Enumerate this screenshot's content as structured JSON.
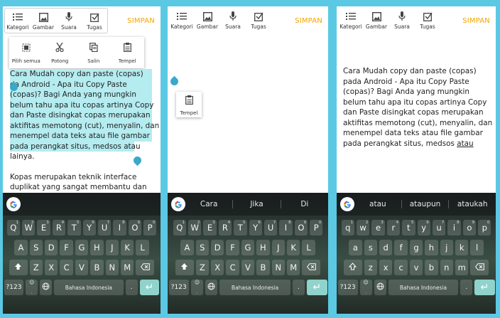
{
  "toolbar": {
    "items": [
      {
        "label": "Kategori",
        "icon": "list-icon"
      },
      {
        "label": "Gambar",
        "icon": "image-icon"
      },
      {
        "label": "Suara",
        "icon": "microphone-icon"
      },
      {
        "label": "Tugas",
        "icon": "checkbox-icon"
      }
    ],
    "save_label": "SIMPAN"
  },
  "context_menu": {
    "items": [
      {
        "label": "Pilih semua",
        "icon": "select-all-icon"
      },
      {
        "label": "Potong",
        "icon": "scissors-icon"
      },
      {
        "label": "Salin",
        "icon": "copy-icon"
      },
      {
        "label": "Tempel",
        "icon": "clipboard-icon"
      }
    ]
  },
  "paste_popup": {
    "label": "Tempel",
    "icon": "clipboard-icon"
  },
  "panel1": {
    "selected_lines": [
      "Cara Mudah copy dan paste (copas)",
      "  da Android - Apa itu Copy Paste",
      "(copas)? Bagi Anda yang mungkin",
      "belum tahu apa itu copas artinya Copy",
      "dan Paste disingkat copas merupakan",
      "aktifitas memotong (cut), menyalin, dan",
      "menempel data teks atau file gambar",
      "pada perangkat situs, medsos atau"
    ],
    "after_line": "lainya.",
    "para2_lines": [
      "Kopas merupakan teknik interface",
      "duplikat yang sangat membantu dan"
    ]
  },
  "panel3": {
    "lines": [
      "Cara Mudah copy dan paste (copas)",
      "pada Android - Apa itu Copy Paste",
      "(copas)? Bagi Anda yang mungkin",
      "belum tahu apa itu copas artinya Copy",
      "dan Paste disingkat copas merupakan",
      "aktifitas memotong (cut), menyalin, dan",
      "menempel data teks atau file gambar",
      "pada perangkat situs, medsos "
    ],
    "last_word": "atau"
  },
  "keyboard": {
    "row1": [
      {
        "k": "Q",
        "n": "1"
      },
      {
        "k": "W",
        "n": "2"
      },
      {
        "k": "E",
        "n": "3"
      },
      {
        "k": "R",
        "n": "4"
      },
      {
        "k": "T",
        "n": "5"
      },
      {
        "k": "Y",
        "n": "6"
      },
      {
        "k": "U",
        "n": "7"
      },
      {
        "k": "I",
        "n": "8"
      },
      {
        "k": "O",
        "n": "9"
      },
      {
        "k": "P",
        "n": "0"
      }
    ],
    "row2": [
      "A",
      "S",
      "D",
      "F",
      "G",
      "H",
      "J",
      "K",
      "L"
    ],
    "row3": [
      "Z",
      "X",
      "C",
      "V",
      "B",
      "N",
      "M"
    ],
    "row1_lower": [
      "q",
      "w",
      "e",
      "r",
      "t",
      "y",
      "u",
      "i",
      "o",
      "p"
    ],
    "row2_lower": [
      "a",
      "s",
      "d",
      "f",
      "g",
      "h",
      "j",
      "k",
      "l"
    ],
    "row3_lower": [
      "z",
      "x",
      "c",
      "v",
      "b",
      "n",
      "m"
    ],
    "sym_label": "?123",
    "space_label": "Bahasa Indonesia",
    "comma": ",",
    "period": "."
  },
  "suggestions": {
    "panel1": [],
    "panel2": [
      "Cara",
      "Jika",
      "Di"
    ],
    "panel3": [
      "atau",
      "ataupun",
      "ataukah"
    ]
  },
  "colors": {
    "accent": "#f2a400",
    "selection": "#b4ecf0",
    "handle": "#3aa9c9",
    "enter": "#8fd3cc"
  }
}
